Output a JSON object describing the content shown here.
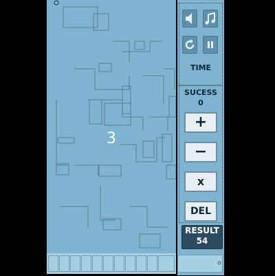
{
  "board": {
    "current_number": "3"
  },
  "panel": {
    "sound_icon": "speaker-icon",
    "music_icon": "music-note-icon",
    "restart_icon": "refresh-icon",
    "pause_icon": "pause-icon",
    "time_label": "TIME",
    "success_label": "SUCESS",
    "success_value": "0",
    "plus_label": "+",
    "minus_label": "−",
    "times_label": "x",
    "del_label": "DEL",
    "result_label": "RESULT",
    "result_value": "54"
  },
  "colors": {
    "board": "#7fb3cf",
    "result_bg": "#2c4b5e",
    "button": "#e8eef2"
  }
}
